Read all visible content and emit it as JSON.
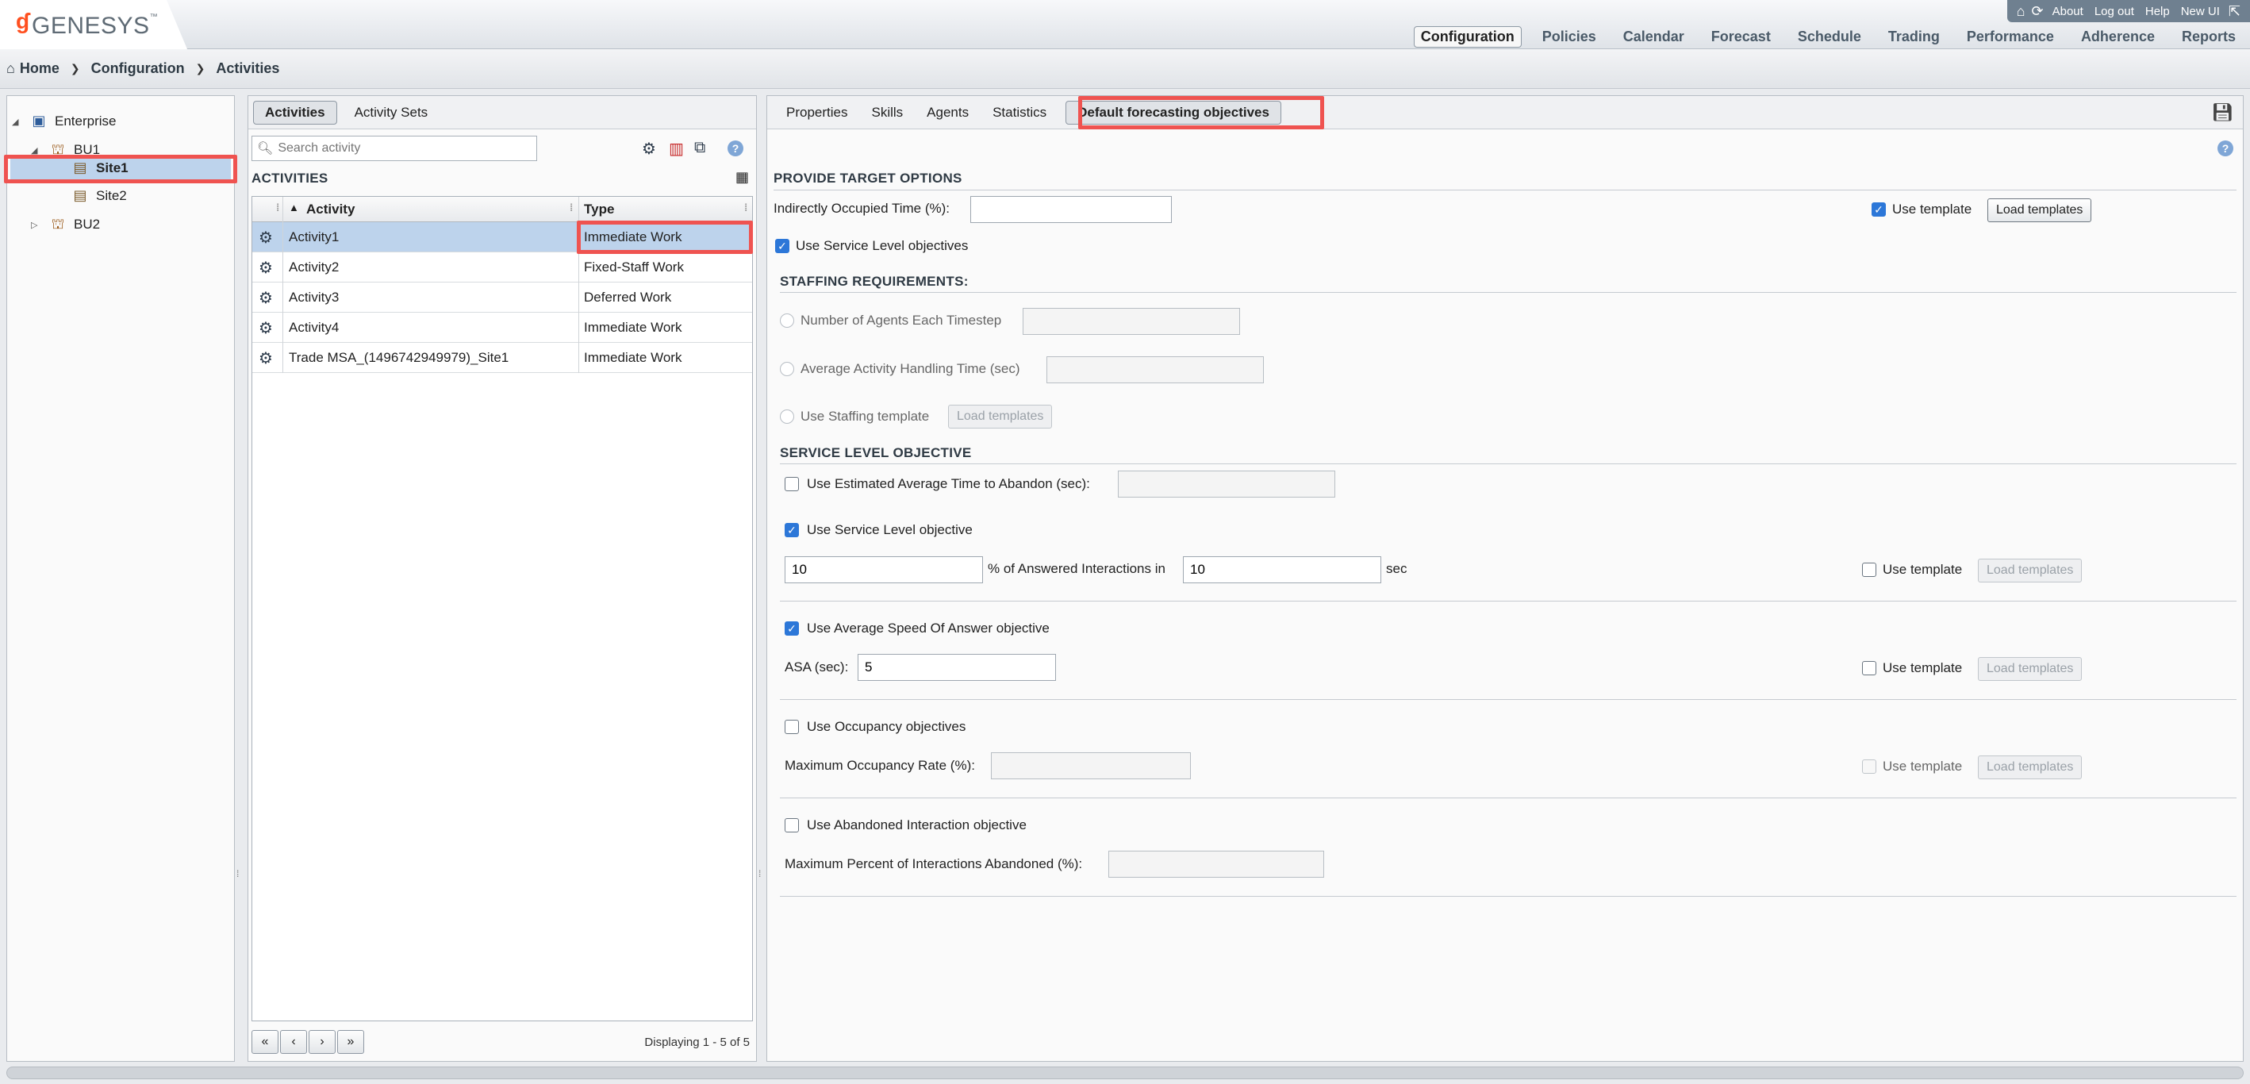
{
  "brand": {
    "logo_mark": "ɠ",
    "logo_text": "GENESYS",
    "logo_tm": "™"
  },
  "util": {
    "about": "About",
    "logout": "Log out",
    "help": "Help",
    "new_ui": "New UI"
  },
  "nav": {
    "configuration": "Configuration",
    "policies": "Policies",
    "calendar": "Calendar",
    "forecast": "Forecast",
    "schedule": "Schedule",
    "trading": "Trading",
    "performance": "Performance",
    "adherence": "Adherence",
    "reports": "Reports"
  },
  "breadcrumb": {
    "home": "Home",
    "configuration": "Configuration",
    "activities": "Activities"
  },
  "tree": {
    "enterprise": "Enterprise",
    "bu1": "BU1",
    "site1": "Site1",
    "site2": "Site2",
    "bu2": "BU2"
  },
  "mid": {
    "tab_activities": "Activities",
    "tab_activity_sets": "Activity Sets",
    "search_placeholder": "Search activity",
    "section": "ACTIVITIES",
    "col_activity": "Activity",
    "col_type": "Type",
    "rows": [
      {
        "activity": "Activity1",
        "type": "Immediate Work"
      },
      {
        "activity": "Activity2",
        "type": "Fixed-Staff Work"
      },
      {
        "activity": "Activity3",
        "type": "Deferred Work"
      },
      {
        "activity": "Activity4",
        "type": "Immediate Work"
      },
      {
        "activity": "Trade MSA_(1496742949979)_Site1",
        "type": "Immediate Work"
      }
    ],
    "displaying": "Displaying 1 - 5 of 5"
  },
  "right": {
    "tabs": {
      "properties": "Properties",
      "skills": "Skills",
      "agents": "Agents",
      "statistics": "Statistics",
      "default_forecasting": "Default forecasting objectives"
    },
    "provide_target": "PROVIDE TARGET OPTIONS",
    "indirect_label": "Indirectly Occupied Time (%):",
    "use_template": "Use template",
    "load_templates": "Load templates",
    "use_sl_objectives": "Use Service Level objectives",
    "staffing_req": "STAFFING REQUIREMENTS:",
    "num_agents": "Number of Agents Each Timestep",
    "aht": "Average Activity Handling Time (sec)",
    "use_staffing_template": "Use Staffing template",
    "slo": "SERVICE LEVEL OBJECTIVE",
    "use_est_abandon": "Use Estimated Average Time to Abandon (sec):",
    "use_sl_objective": "Use Service Level objective",
    "sl_percent": "10",
    "answered_in": "% of Answered Interactions in",
    "sl_seconds": "10",
    "sec": "sec",
    "use_asa": "Use Average Speed Of Answer objective",
    "asa_label": "ASA (sec):",
    "asa_value": "5",
    "use_occupancy": "Use Occupancy objectives",
    "max_occupancy": "Maximum Occupancy Rate (%):",
    "use_abandoned": "Use Abandoned Interaction objective",
    "max_abandoned": "Maximum Percent of Interactions Abandoned (%):"
  }
}
